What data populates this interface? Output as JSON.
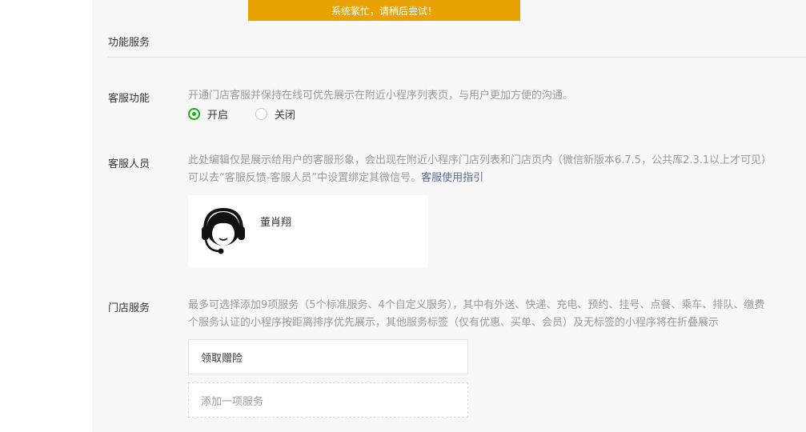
{
  "toast": {
    "text": "系统繁忙，请稍后尝试！",
    "color": "#e8a202"
  },
  "section": {
    "title": "功能服务"
  },
  "customer_service": {
    "label": "客服功能",
    "description": "开通门店客服并保持在线可优先展示在附近小程序列表页，与用户更加方便的沟通。",
    "options": [
      {
        "label": "开启",
        "selected": true
      },
      {
        "label": "关闭",
        "selected": false
      }
    ],
    "accent": "#1aad19"
  },
  "staff": {
    "label": "客服人员",
    "description_line1": "此处编辑仅是展示给用户的客服形象，会出现在附近小程序门店列表和门店页内（微信新版本6.7.5，公共库2.3.1以上才可见）",
    "description_line2": "可以去“客服反馈-客服人员”中设置绑定其微信号。",
    "guide_link": "客服使用指引",
    "card": {
      "name": "董肖翔",
      "avatar_icon": "headset-agent-icon"
    }
  },
  "store_service": {
    "label": "门店服务",
    "description_line1": "最多可选择添加9项服务（5个标准服务、4个自定义服务），其中有外送、快递、充电、预约、挂号、点餐、乘车、排队、缴费",
    "description_line2": "个服务认证的小程序按距离排序优先展示，其他服务标签（仅有优惠、买单、会员）及无标签的小程序将在折叠展示",
    "items": [
      "领取赠险"
    ],
    "add_label": "添加一项服务"
  }
}
